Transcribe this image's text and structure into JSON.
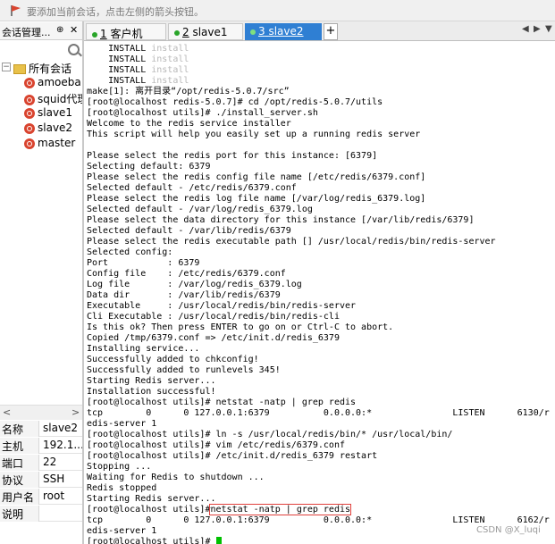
{
  "topbar": {
    "hint": "要添加当前会话，点击左侧的箭头按钮。"
  },
  "panel": {
    "title": "会话管理...",
    "pin": "⊕",
    "close": "✕"
  },
  "tree": {
    "root_label": "所有会话",
    "expander": "−",
    "sessions": [
      "amoeba",
      "squid代理",
      "slave1",
      "slave2",
      "master"
    ]
  },
  "scroll": {
    "left": "<",
    "right": ">"
  },
  "props": [
    {
      "k": "名称",
      "v": "slave2"
    },
    {
      "k": "主机",
      "v": "192.1..."
    },
    {
      "k": "端口",
      "v": "22"
    },
    {
      "k": "协议",
      "v": "SSH"
    },
    {
      "k": "用户名",
      "v": "root"
    },
    {
      "k": "说明",
      "v": ""
    }
  ],
  "tabs": [
    {
      "num": "1",
      "label": "客户机"
    },
    {
      "num": "2",
      "label": "slave1"
    },
    {
      "num": "3",
      "label": "slave2"
    }
  ],
  "tab_controls": {
    "new": "+",
    "prev": "◀",
    "next": "▶",
    "menu": "▼"
  },
  "terminal": {
    "lines": [
      {
        "t": "    INSTALL ",
        "d": "install"
      },
      {
        "t": "    INSTALL ",
        "d": "install"
      },
      {
        "t": "    INSTALL ",
        "d": "install"
      },
      {
        "t": "    INSTALL ",
        "d": "install"
      },
      {
        "t": "make[1]: 离开目录“/opt/redis-5.0.7/src”"
      },
      {
        "t": "[root@localhost redis-5.0.7]# cd /opt/redis-5.0.7/utils"
      },
      {
        "t": "[root@localhost utils]# ./install_server.sh"
      },
      {
        "t": "Welcome to the redis service installer"
      },
      {
        "t": "This script will help you easily set up a running redis server"
      },
      {
        "t": ""
      },
      {
        "t": "Please select the redis port for this instance: [6379]"
      },
      {
        "t": "Selecting default: 6379"
      },
      {
        "t": "Please select the redis config file name [/etc/redis/6379.conf]"
      },
      {
        "t": "Selected default - /etc/redis/6379.conf"
      },
      {
        "t": "Please select the redis log file name [/var/log/redis_6379.log]"
      },
      {
        "t": "Selected default - /var/log/redis_6379.log"
      },
      {
        "t": "Please select the data directory for this instance [/var/lib/redis/6379]"
      },
      {
        "t": "Selected default - /var/lib/redis/6379"
      },
      {
        "t": "Please select the redis executable path [] /usr/local/redis/bin/redis-server"
      },
      {
        "t": "Selected config:"
      },
      {
        "t": "Port           : 6379"
      },
      {
        "t": "Config file    : /etc/redis/6379.conf"
      },
      {
        "t": "Log file       : /var/log/redis_6379.log"
      },
      {
        "t": "Data dir       : /var/lib/redis/6379"
      },
      {
        "t": "Executable     : /usr/local/redis/bin/redis-server"
      },
      {
        "t": "Cli Executable : /usr/local/redis/bin/redis-cli"
      },
      {
        "t": "Is this ok? Then press ENTER to go on or Ctrl-C to abort."
      },
      {
        "t": "Copied /tmp/6379.conf => /etc/init.d/redis_6379"
      },
      {
        "t": "Installing service..."
      },
      {
        "t": "Successfully added to chkconfig!"
      },
      {
        "t": "Successfully added to runlevels 345!"
      },
      {
        "t": "Starting Redis server..."
      },
      {
        "t": "Installation successful!"
      },
      {
        "t": "[root@localhost utils]# netstat -natp | grep redis"
      },
      {
        "t": "tcp        0      0 127.0.0.1:6379          0.0.0.0:*               LISTEN      6130/r"
      },
      {
        "t": "edis-server 1"
      },
      {
        "t": "[root@localhost utils]# ln -s /usr/local/redis/bin/* /usr/local/bin/"
      },
      {
        "t": "[root@localhost utils]# vim /etc/redis/6379.conf"
      },
      {
        "t": "[root@localhost utils]# /etc/init.d/redis_6379 restart"
      },
      {
        "t": "Stopping ..."
      },
      {
        "t": "Waiting for Redis to shutdown ..."
      },
      {
        "t": "Redis stopped"
      },
      {
        "t": "Starting Redis server..."
      },
      {
        "t": "[root@localhost utils]#",
        "h": "netstat -natp | grep redis"
      },
      {
        "t": "tcp        0      0 127.0.0.1:6379          0.0.0.0:*               LISTEN      6162/r"
      },
      {
        "t": "edis-server 1"
      },
      {
        "t": "[root@localhost utils]# ",
        "c": true
      }
    ]
  },
  "watermark": "CSDN @X_luqi"
}
